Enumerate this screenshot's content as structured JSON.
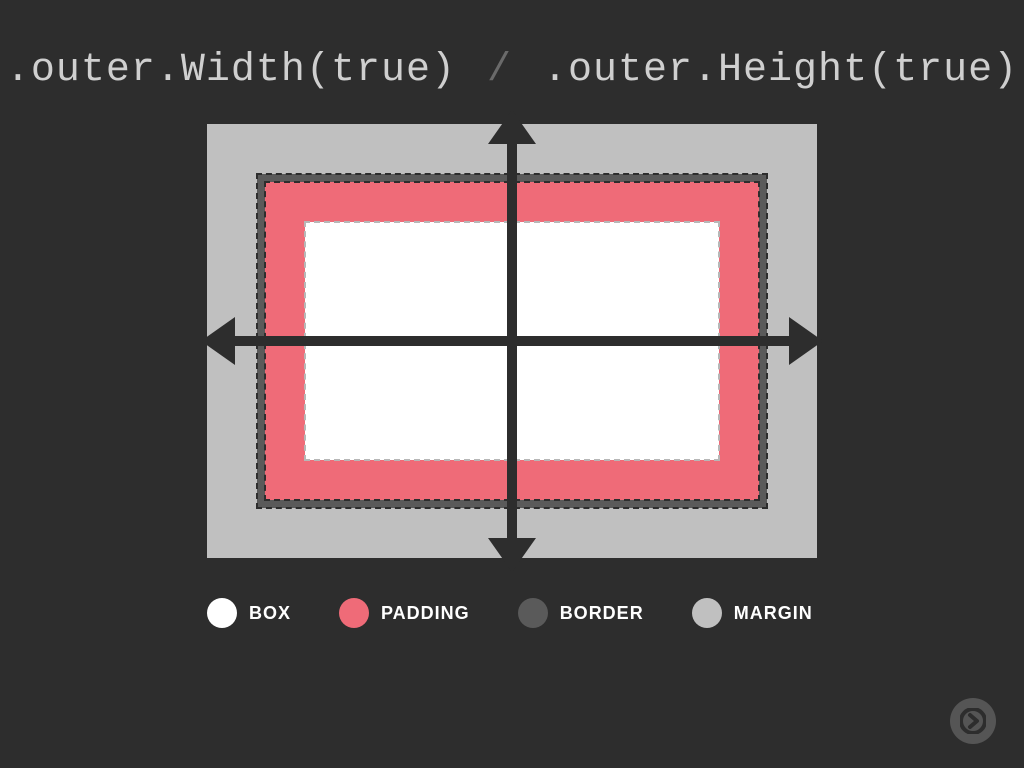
{
  "title": {
    "method_left": ".outer.Width(true)",
    "separator": "/",
    "method_right": ".outer.Height(true)"
  },
  "legend": {
    "box": "BOX",
    "padding": "PADDING",
    "border": "BORDER",
    "margin": "MARGIN"
  },
  "colors": {
    "background": "#2d2d2d",
    "box": "#ffffff",
    "padding": "#ef6b78",
    "border": "#5a5a5a",
    "margin": "#c0c0c0",
    "title_text": "#cfcfcf",
    "title_separator": "#6a6a6a",
    "arrow": "#2d2d2d",
    "legend_text": "#ffffff",
    "next_button_bg": "#555555",
    "next_button_fg": "#2d2d2d"
  },
  "chart_data": {
    "type": "diagram",
    "title": ".outer.Width(true) / .outer.Height(true)",
    "description": "CSS box model diagram showing that outerWidth(true) and outerHeight(true) span the full box including content, padding, border, and margin.",
    "layers": [
      {
        "name": "margin",
        "color": "#c0c0c0",
        "included": true
      },
      {
        "name": "border",
        "color": "#5a5a5a",
        "included": true
      },
      {
        "name": "padding",
        "color": "#ef6b78",
        "included": true
      },
      {
        "name": "box",
        "color": "#ffffff",
        "included": true
      }
    ],
    "arrows": {
      "horizontal_spans": "margin",
      "vertical_spans": "margin"
    },
    "legend": [
      "BOX",
      "PADDING",
      "BORDER",
      "MARGIN"
    ]
  }
}
